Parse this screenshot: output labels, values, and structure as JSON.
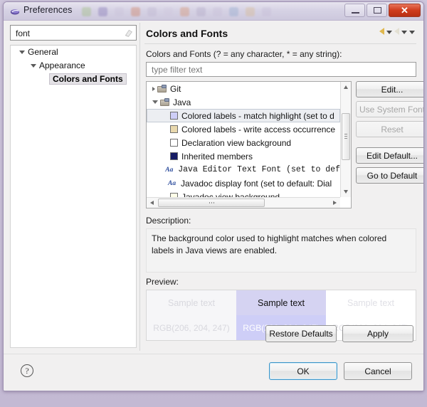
{
  "window": {
    "title": "Preferences",
    "icon": "eclipse-icon",
    "controls": {
      "minimize": "minimize-icon",
      "maximize": "maximize-icon",
      "close": "✕"
    }
  },
  "left_panel": {
    "filter": {
      "value": "font",
      "placeholder": "",
      "clear_icon": "eraser-icon"
    },
    "tree": [
      {
        "label": "General",
        "depth": 0,
        "expanded": true,
        "selected": false
      },
      {
        "label": "Appearance",
        "depth": 1,
        "expanded": true,
        "selected": false
      },
      {
        "label": "Colors and Fonts",
        "depth": 2,
        "expanded": null,
        "selected": true
      }
    ]
  },
  "right_panel": {
    "title": "Colors and Fonts",
    "nav": [
      {
        "name": "back-arrow-icon",
        "state": "enabled"
      },
      {
        "name": "back-dropdown-caret-icon",
        "state": "enabled"
      },
      {
        "name": "forward-arrow-icon",
        "state": "disabled"
      },
      {
        "name": "forward-dropdown-caret-icon",
        "state": "enabled"
      },
      {
        "name": "view-menu-caret-icon",
        "state": "enabled"
      }
    ],
    "filter_label": "Colors and Fonts (? = any character, * = any string):",
    "filter_input": {
      "value": "",
      "placeholder": "type filter text"
    },
    "list": [
      {
        "label": "Git",
        "kind": "category",
        "depth": 0,
        "expanded": false,
        "selected": false,
        "swatch": null
      },
      {
        "label": "Java",
        "kind": "category",
        "depth": 0,
        "expanded": true,
        "selected": false,
        "swatch": null
      },
      {
        "label": "Colored labels - match highlight (set to d",
        "kind": "color",
        "depth": 1,
        "selected": true,
        "swatch": "#cecef7"
      },
      {
        "label": "Colored labels - write access occurrence",
        "kind": "color",
        "depth": 1,
        "selected": false,
        "swatch": "#e8d8ad"
      },
      {
        "label": "Declaration view background",
        "kind": "color",
        "depth": 1,
        "selected": false,
        "swatch": "#ffffff"
      },
      {
        "label": "Inherited members",
        "kind": "color",
        "depth": 1,
        "selected": false,
        "swatch": "#151b63"
      },
      {
        "label": "Java Editor Text Font (set to def",
        "kind": "font",
        "depth": 1,
        "selected": false,
        "swatch": null
      },
      {
        "label": "Javadoc display font (set to default: Dial",
        "kind": "font",
        "depth": 1,
        "selected": false,
        "swatch": null
      },
      {
        "label": "Javadoc view background",
        "kind": "color",
        "depth": 1,
        "selected": false,
        "swatch": "#ffffe8"
      }
    ],
    "side_buttons": [
      {
        "label": "Edit...",
        "enabled": true
      },
      {
        "label": "Use System Font",
        "enabled": false
      },
      {
        "label": "Reset",
        "enabled": false
      },
      {
        "label": "Edit Default...",
        "enabled": true
      },
      {
        "label": "Go to Default",
        "enabled": true
      }
    ],
    "description_label": "Description:",
    "description_text": "The background color used to highlight matches when colored labels in Java views are enabled.",
    "preview_label": "Preview:",
    "preview_cells": [
      {
        "sample": "Sample text",
        "rgb": "RGB(206, 204, 247)",
        "bg": "#f6f6f8",
        "top_text_color": "#d8d8de",
        "bot_text_color": "#d8d8de",
        "bot_bg": "#f6f6f8"
      },
      {
        "sample": "Sample text",
        "rgb": "RGB(206, 204, 247)",
        "bg": "#d5d3f2",
        "top_text_color": "#111111",
        "bot_text_color": "#ffffff",
        "bot_bg": "#cecef7"
      },
      {
        "sample": "Sample text",
        "rgb": "RGB(206, 204, 247)",
        "bg": "#ffffff",
        "top_text_color": "#e0e0e6",
        "bot_text_color": "#dedee4",
        "bot_bg": "#ffffff"
      }
    ],
    "bottom_buttons": [
      {
        "label": "Restore Defaults",
        "enabled": true
      },
      {
        "label": "Apply",
        "enabled": true
      }
    ]
  },
  "footer": {
    "help_icon": "?",
    "buttons": [
      {
        "label": "OK",
        "focused": true
      },
      {
        "label": "Cancel",
        "focused": false
      }
    ]
  }
}
